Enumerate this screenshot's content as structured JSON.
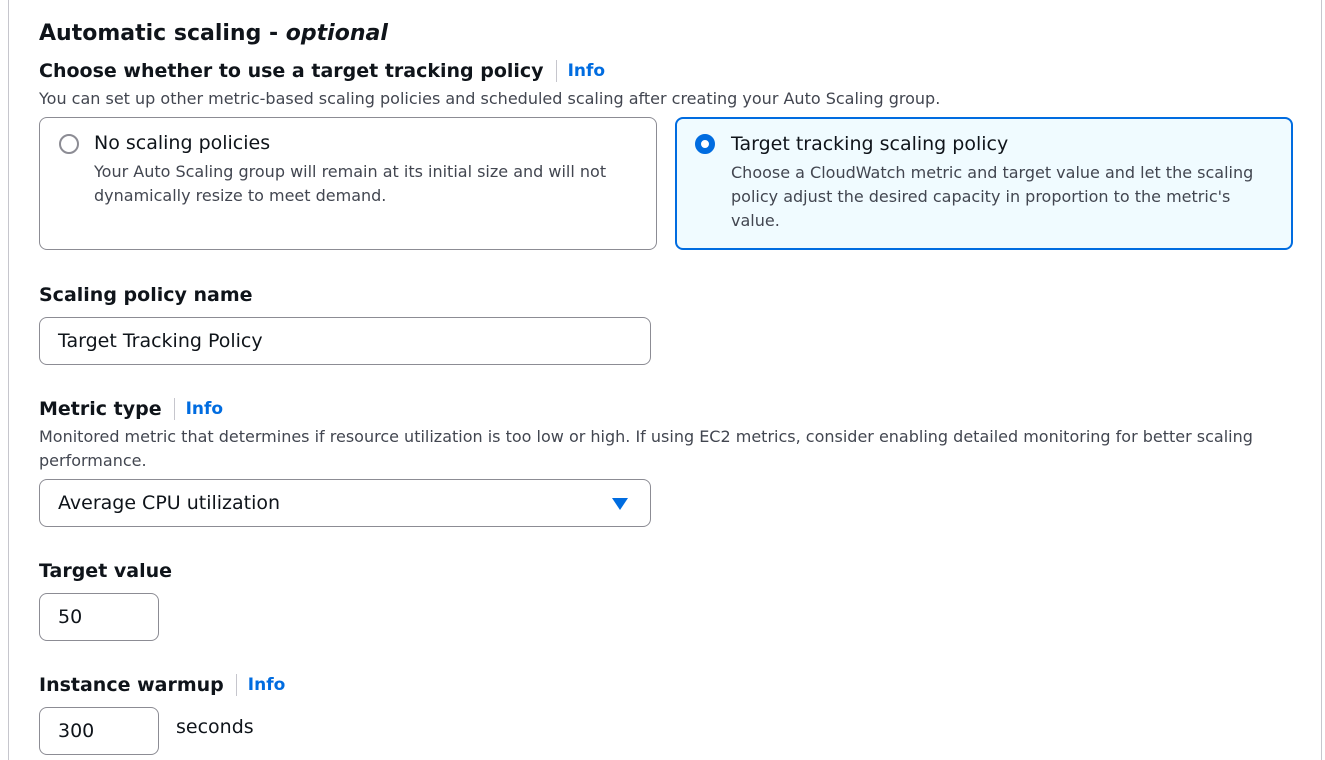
{
  "section": {
    "title": "Automatic scaling - ",
    "title_optional": "optional"
  },
  "policy_choice": {
    "label": "Choose whether to use a target tracking policy",
    "info": "Info",
    "description": "You can set up other metric-based scaling policies and scheduled scaling after creating your Auto Scaling group.",
    "options": [
      {
        "title": "No scaling policies",
        "description": "Your Auto Scaling group will remain at its initial size and will not dynamically resize to meet demand.",
        "selected": false
      },
      {
        "title": "Target tracking scaling policy",
        "description": "Choose a CloudWatch metric and target value and let the scaling policy adjust the desired capacity in proportion to the metric's value.",
        "selected": true
      }
    ]
  },
  "policy_name": {
    "label": "Scaling policy name",
    "value": "Target Tracking Policy"
  },
  "metric_type": {
    "label": "Metric type",
    "info": "Info",
    "description": "Monitored metric that determines if resource utilization is too low or high. If using EC2 metrics, consider enabling detailed monitoring for better scaling performance.",
    "value": "Average CPU utilization"
  },
  "target_value": {
    "label": "Target value",
    "value": "50"
  },
  "instance_warmup": {
    "label": "Instance warmup",
    "info": "Info",
    "value": "300",
    "unit": "seconds"
  },
  "colors": {
    "accent": "#006ce0",
    "selected_bg": "#f0fbff",
    "border": "#8c8c94",
    "text": "#0f141a",
    "secondary_text": "#424650"
  }
}
